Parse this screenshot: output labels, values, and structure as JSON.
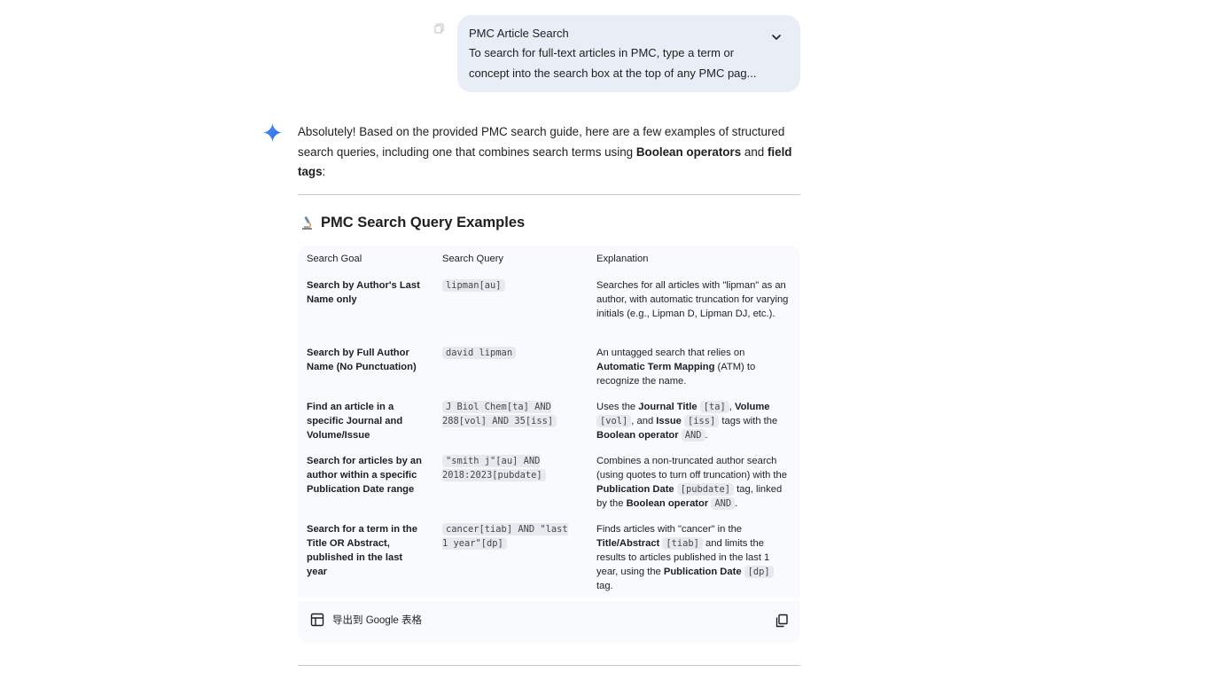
{
  "prompt": {
    "title": "PMC Article Search",
    "body": "To search for full-text articles in PMC, type a term or concept into the search box at the top of any PMC pag...",
    "expand_icon": "chevron-down-icon"
  },
  "response": {
    "intro_a": "Absolutely! Based on the provided PMC search guide, here are a few examples of structured search queries, including one that combines search terms using ",
    "intro_bold1": "Boolean operators",
    "intro_mid": " and ",
    "intro_bold2": "field tags",
    "intro_end": ":",
    "section_emoji": "microscope-icon",
    "section_title": "PMC Search Query Examples"
  },
  "table": {
    "headers": [
      "Search Goal",
      "Search Query",
      "Explanation"
    ],
    "rows": [
      {
        "goal": "Search by Author's Last Name only",
        "query": "lipman[au]",
        "exp": {
          "t1": "Searches for all articles with \"lipman\" as an author, with automatic truncation for varying initials (e.g., Lipman D, Lipman DJ, etc.)."
        }
      },
      {
        "goal": "Search by Full Author Name (No Punctuation)",
        "query": "david lipman",
        "exp": {
          "t1": "An untagged search that relies on ",
          "b1": "Automatic Term Mapping",
          "t2": " (ATM) to recognize the name."
        }
      },
      {
        "goal": "Find an article in a specific Journal and Volume/Issue",
        "query": "J Biol Chem[ta] AND 288[vol] AND 35[iss]",
        "exp": {
          "t1": "Uses the ",
          "b1": "Journal Title",
          "c1": "[ta]",
          "t2": ", ",
          "b2": "Volume",
          "c2": "[vol]",
          "t3": ", and ",
          "b3": "Issue",
          "c3": "[iss]",
          "t4": " tags with the ",
          "b4": "Boolean operator",
          "c4": "AND",
          "t5": "."
        }
      },
      {
        "goal": "Search for articles by an author within a specific Publication Date range",
        "query": "\"smith j\"[au] AND 2018:2023[pubdate]",
        "exp": {
          "t1": "Combines a non-truncated author search (using quotes to turn off truncation) with the ",
          "b1": "Publication Date",
          "c1": "[pubdate]",
          "t2": " tag, linked by the ",
          "b2": "Boolean operator",
          "c2": "AND",
          "t3": "."
        }
      },
      {
        "goal": "Search for a term in the Title OR Abstract, published in the last year",
        "query": "cancer[tiab] AND \"last 1 year\"[dp]",
        "exp": {
          "t1": "Finds articles with \"cancer\" in the ",
          "b1": "Title/Abstract",
          "c1": "[tiab]",
          "t2": " and limits the results to articles published in the last 1 year, using the ",
          "b2": "Publication Date",
          "c2": "[dp]",
          "t3": " tag."
        }
      }
    ],
    "export_label": "导出到 Google 表格",
    "export_icon": "table-icon",
    "copy_icon": "copy-icon"
  }
}
